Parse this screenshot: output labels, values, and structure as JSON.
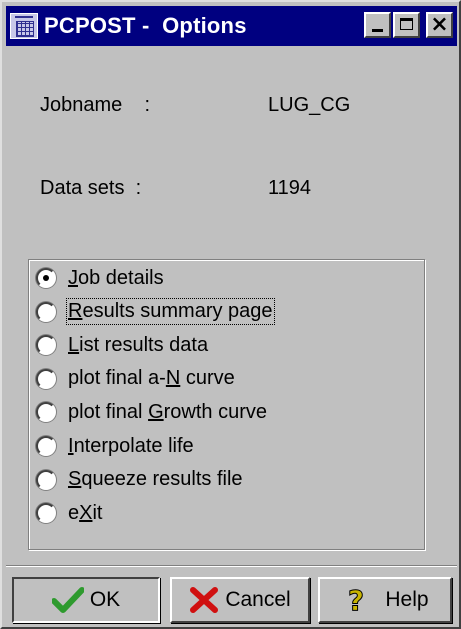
{
  "window": {
    "title": "PCPOST -  Options"
  },
  "info": {
    "jobname_label": "Jobname    :",
    "jobname_value": "LUG_CG",
    "datasets_label": "Data sets  :",
    "datasets_value": "1194"
  },
  "options": {
    "selected_index": 0,
    "items": [
      {
        "pre": "",
        "key": "J",
        "post": "ob details",
        "checked": true
      },
      {
        "pre": "",
        "key": "R",
        "post": "esults summary page",
        "checked": false
      },
      {
        "pre": "",
        "key": "L",
        "post": "ist results data",
        "checked": false
      },
      {
        "pre": "plot final a-",
        "key": "N",
        "post": " curve",
        "checked": false
      },
      {
        "pre": "plot final ",
        "key": "G",
        "post": "rowth curve",
        "checked": false
      },
      {
        "pre": "",
        "key": "I",
        "post": "nterpolate life",
        "checked": false
      },
      {
        "pre": "",
        "key": "S",
        "post": "queeze results file",
        "checked": false
      },
      {
        "pre": "e",
        "key": "X",
        "post": "it",
        "checked": false
      }
    ]
  },
  "buttons": {
    "ok_label": "OK",
    "cancel_label": "Cancel",
    "help_label": "Help",
    "ok_icon": "checkmark-icon",
    "cancel_icon": "cross-icon",
    "help_icon": "question-mark-icon"
  },
  "colors": {
    "titlebar": "#000080",
    "window_bg": "#c0c0c0",
    "ok_check": "#2e9a2e",
    "cancel_cross": "#d01010",
    "help_question": "#c8b400"
  }
}
